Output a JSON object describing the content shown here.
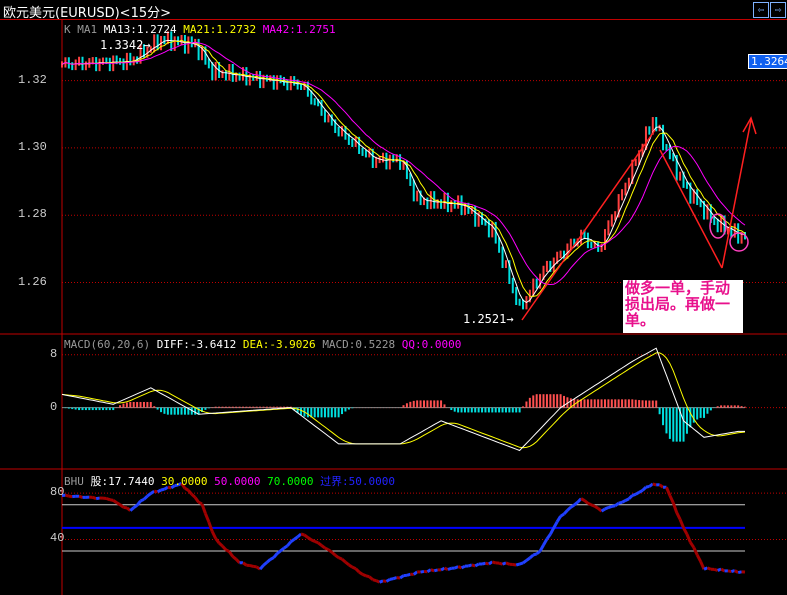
{
  "window": {
    "title": "欧元美元(EURUSD)<15分>",
    "nav_prev": "⇦",
    "nav_next": "⇨"
  },
  "main_legend": {
    "k": "K",
    "ma1": "MA1",
    "ma13": "MA13:1.2724",
    "ma21": "MA21:1.2732",
    "ma42": "MA42:1.2751"
  },
  "macd_legend": {
    "name": "MACD(60,20,6)",
    "diff": "DIFF:-3.6412",
    "dea": "DEA:-3.9026",
    "macd": "MACD:0.5228",
    "qq": "QQ:0.0000"
  },
  "bhu_legend": {
    "name": "BHU",
    "gu": "股:17.7440",
    "v30": "30.0000",
    "v50": "50.0000",
    "v70": "70.0000",
    "guojie": "过界:50.0000"
  },
  "current_price": "1.3264",
  "annotations": {
    "high": "1.3342",
    "low": "1.2521",
    "note": "做多一单，手动损出局。再做一单。"
  },
  "colors": {
    "price": "#00e0e0",
    "ma13": "#ffffff",
    "ma21": "#ffff00",
    "ma42": "#ff00ff",
    "grid": "#c00000",
    "note": "#e8108c"
  },
  "chart_data": [
    {
      "type": "line",
      "title": "欧元美元(EURUSD)<15分>",
      "ylim": [
        1.245,
        1.338
      ],
      "yticks": [
        "1.32",
        "1.30",
        "1.28",
        "1.26"
      ],
      "yticks_values": [
        1.32,
        1.3,
        1.28,
        1.26
      ],
      "bars": 200,
      "series": [
        {
          "name": "price",
          "points": [
            [
              0,
              1.3248
            ],
            [
              20,
              1.3257
            ],
            [
              29,
              1.3322
            ],
            [
              39,
              1.3307
            ],
            [
              44,
              1.3227
            ],
            [
              55,
              1.3209
            ],
            [
              70,
              1.3188
            ],
            [
              79,
              1.3069
            ],
            [
              91,
              1.2964
            ],
            [
              99,
              1.2964
            ],
            [
              104,
              1.2845
            ],
            [
              117,
              1.283
            ],
            [
              126,
              1.2755
            ],
            [
              134,
              1.2522
            ],
            [
              141,
              1.2636
            ],
            [
              152,
              1.274
            ],
            [
              157,
              1.2696
            ],
            [
              173,
              1.3084
            ],
            [
              182,
              1.289
            ],
            [
              191,
              1.2779
            ],
            [
              198,
              1.274
            ]
          ]
        }
      ]
    },
    {
      "type": "line",
      "title": "MACD(60,20,6)",
      "ylim": [
        -9,
        11
      ],
      "yticks": [
        "8",
        "0"
      ],
      "yticks_values": [
        8,
        0
      ],
      "series": [
        {
          "name": "DIFF",
          "points": [
            [
              0,
              2
            ],
            [
              15,
              0.5
            ],
            [
              26,
              3
            ],
            [
              40,
              -1
            ],
            [
              67,
              0
            ],
            [
              81,
              -5.5
            ],
            [
              99,
              -5.5
            ],
            [
              111,
              -2
            ],
            [
              134,
              -6.5
            ],
            [
              146,
              0
            ],
            [
              152,
              2
            ],
            [
              167,
              7
            ],
            [
              174,
              9
            ],
            [
              182,
              -2
            ],
            [
              188,
              -4.5
            ],
            [
              198,
              -3.6
            ]
          ]
        }
      ]
    },
    {
      "type": "line",
      "title": "BHU",
      "ylim": [
        -8,
        100
      ],
      "yticks": [
        "80",
        "40"
      ],
      "yticks_values": [
        80,
        40
      ],
      "hlines": [
        70,
        50,
        30
      ],
      "series": [
        {
          "name": "股",
          "points": [
            [
              0,
              78
            ],
            [
              14,
              75
            ],
            [
              20,
              65
            ],
            [
              26,
              80
            ],
            [
              35,
              88
            ],
            [
              41,
              70
            ],
            [
              45,
              40
            ],
            [
              52,
              20
            ],
            [
              58,
              15
            ],
            [
              64,
              30
            ],
            [
              70,
              45
            ],
            [
              76,
              35
            ],
            [
              88,
              10
            ],
            [
              93,
              3
            ],
            [
              105,
              12
            ],
            [
              114,
              15
            ],
            [
              126,
              20
            ],
            [
              134,
              18
            ],
            [
              140,
              30
            ],
            [
              146,
              60
            ],
            [
              152,
              75
            ],
            [
              158,
              65
            ],
            [
              164,
              72
            ],
            [
              173,
              88
            ],
            [
              177,
              85
            ],
            [
              182,
              50
            ],
            [
              188,
              15
            ],
            [
              198,
              12
            ]
          ]
        }
      ]
    }
  ]
}
